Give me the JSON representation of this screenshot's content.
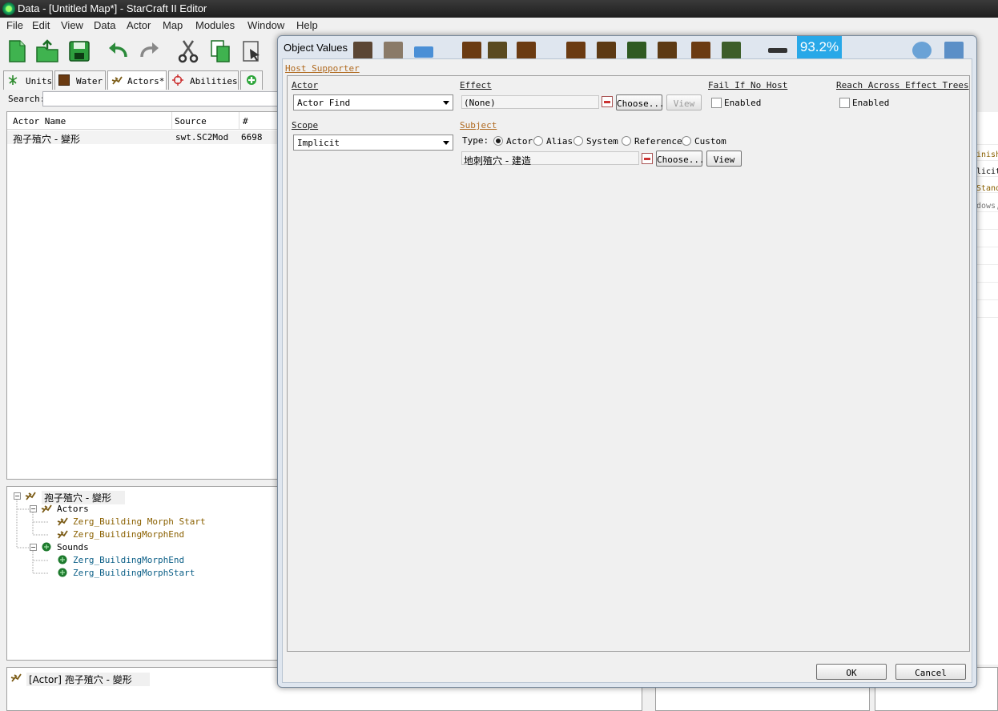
{
  "window": {
    "title": "Data - [Untitled Map*] - StarCraft II Editor"
  },
  "menu": [
    "File",
    "Edit",
    "View",
    "Data",
    "Actor",
    "Map",
    "Modules",
    "Window",
    "Help"
  ],
  "tabs": [
    {
      "label": "Units",
      "icon": "units-icon"
    },
    {
      "label": "Water",
      "icon": "water-icon"
    },
    {
      "label": "Actors*",
      "icon": "actor-icon"
    },
    {
      "label": "Abilities",
      "icon": "abilities-icon"
    },
    {
      "label": "",
      "icon": "add-tab-icon"
    }
  ],
  "search": {
    "label": "Search:",
    "value": ""
  },
  "list": {
    "columns": [
      "Actor Name",
      "Source",
      "#"
    ],
    "rows": [
      {
        "name": "孢子殖穴 - 變形",
        "source": "swt.SC2Mod",
        "count": "6698"
      }
    ]
  },
  "tree": {
    "root": "孢子殖穴 - 變形",
    "groups": [
      {
        "label": "Actors",
        "items": [
          "Zerg_Building Morph Start",
          "Zerg_BuildingMorphEnd"
        ]
      },
      {
        "label": "Sounds",
        "items": [
          "Zerg_BuildingMorphEnd",
          "Zerg_BuildingMorphStart"
        ]
      }
    ]
  },
  "status": {
    "text": "[Actor] 孢子殖穴 - 變形"
  },
  "right_fragments": [
    "inish",
    "licit",
    "Stand",
    "dows,"
  ],
  "dialog": {
    "title": "Object Values",
    "zoom": "93.2%",
    "host_link": "Host Supporter",
    "actor": {
      "label": "Actor",
      "value": "Actor Find"
    },
    "effect": {
      "label": "Effect",
      "value": "(None)",
      "choose": "Choose...",
      "view": "View"
    },
    "fail_if_no_host": {
      "label": "Fail If No Host",
      "checkbox": "Enabled",
      "checked": false
    },
    "reach_across": {
      "label": "Reach Across Effect Trees",
      "checkbox": "Enabled",
      "checked": false
    },
    "scope": {
      "label": "Scope",
      "value": "Implicit"
    },
    "subject": {
      "label": "Subject",
      "type_label": "Type:",
      "types": [
        "Actor",
        "Alias",
        "System",
        "Reference",
        "Custom"
      ],
      "selected_type": "Actor",
      "value": "地刺殖穴 - 建造",
      "choose": "Choose...",
      "view": "View"
    },
    "ok": "OK",
    "cancel": "Cancel"
  }
}
